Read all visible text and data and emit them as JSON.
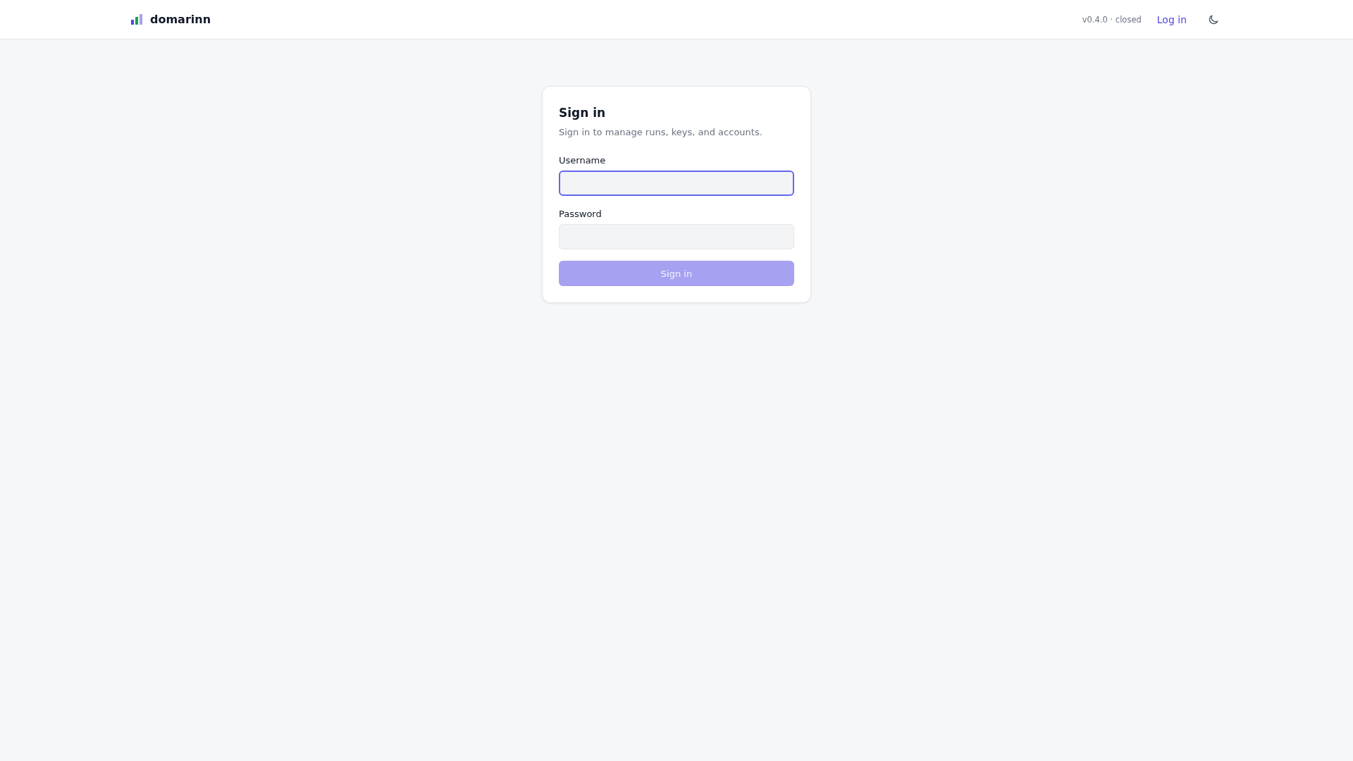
{
  "header": {
    "brand": "domarinn",
    "version": "v0.4.0 · closed",
    "login_link": "Log in"
  },
  "card": {
    "title": "Sign in",
    "subtitle": "Sign in to manage runs, keys, and accounts.",
    "fields": [
      {
        "label": "Username",
        "focused": true
      },
      {
        "label": "Password",
        "focused": false
      }
    ],
    "submit": {
      "label": "Sign in",
      "disabled": true
    }
  }
}
